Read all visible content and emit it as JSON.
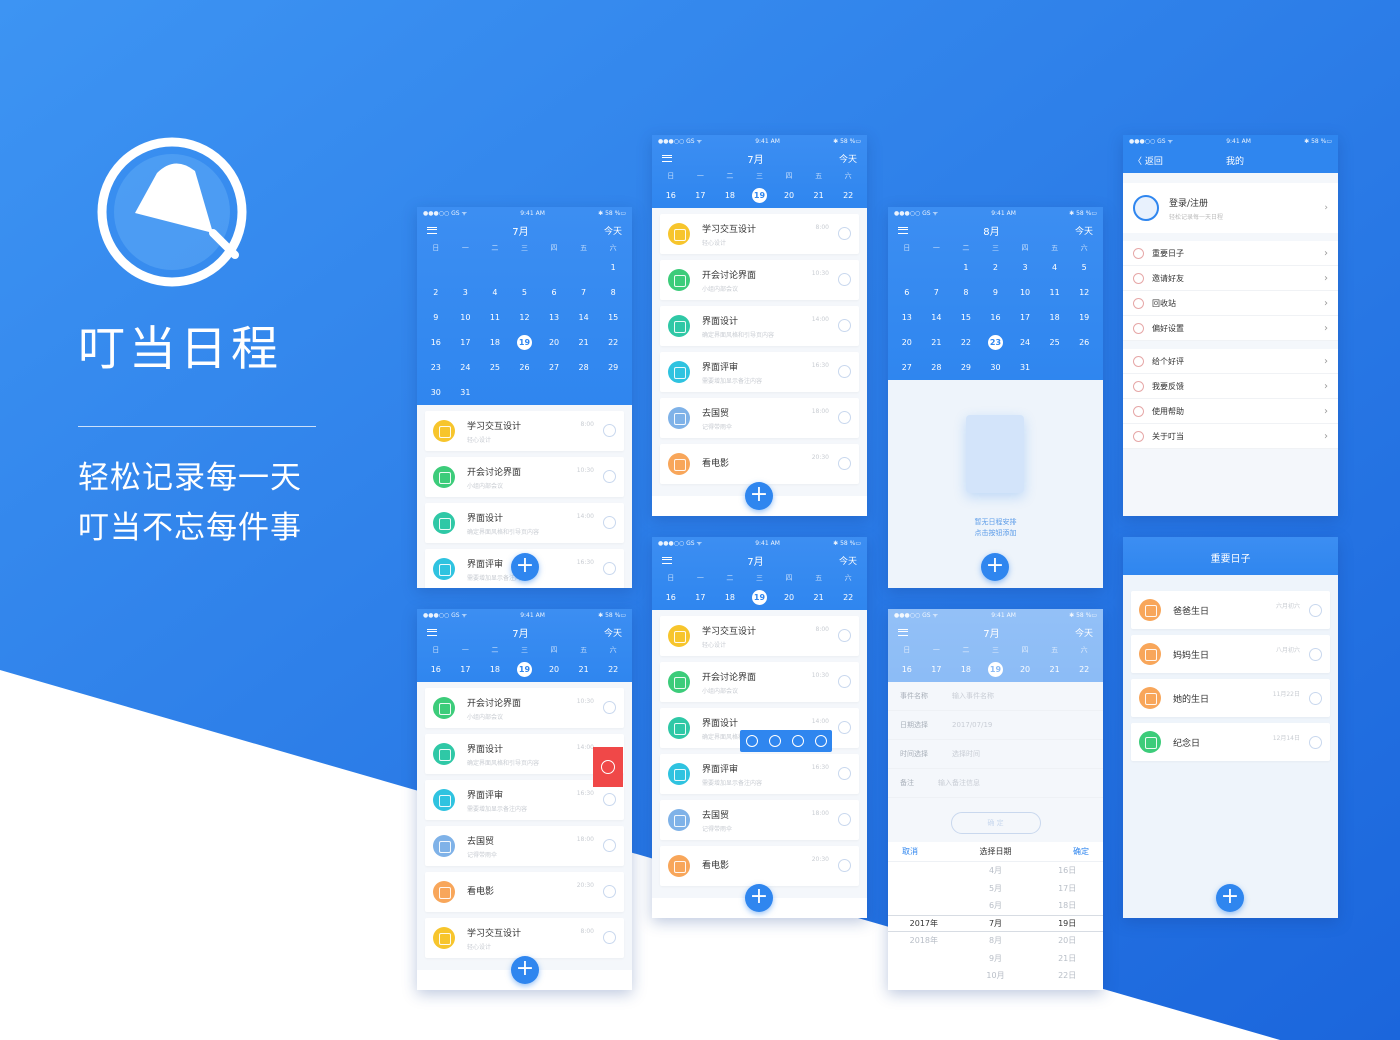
{
  "brand": {
    "title": "叮当日程",
    "slogan_1": "轻松记录每一天",
    "slogan_2": "叮当不忘每件事"
  },
  "status": {
    "carrier": "●●●○○ GS ᯤ",
    "time": "9:41 AM",
    "battery": "✱ 58 %▭"
  },
  "weekdays": [
    "日",
    "一",
    "二",
    "三",
    "四",
    "五",
    "六"
  ],
  "today_label": "今天",
  "month_july": "7月",
  "month_aug": "8月",
  "july_weeks": [
    [
      "",
      "",
      "",
      "",
      "",
      "",
      "1"
    ],
    [
      "2",
      "3",
      "4",
      "5",
      "6",
      "7",
      "8"
    ],
    [
      "9",
      "10",
      "11",
      "12",
      "13",
      "14",
      "15"
    ],
    [
      "16",
      "17",
      "18",
      "19",
      "20",
      "21",
      "22"
    ],
    [
      "23",
      "24",
      "25",
      "26",
      "27",
      "28",
      "29"
    ],
    [
      "30",
      "31",
      "",
      "",
      "",
      "",
      ""
    ]
  ],
  "aug_weeks": [
    [
      "",
      "",
      "1",
      "2",
      "3",
      "4",
      "5"
    ],
    [
      "6",
      "7",
      "8",
      "9",
      "10",
      "11",
      "12"
    ],
    [
      "13",
      "14",
      "15",
      "16",
      "17",
      "18",
      "19"
    ],
    [
      "20",
      "21",
      "22",
      "23",
      "24",
      "25",
      "26"
    ],
    [
      "27",
      "28",
      "29",
      "30",
      "31",
      "",
      ""
    ]
  ],
  "week_row": [
    "16",
    "17",
    "18",
    "19",
    "20",
    "21",
    "22"
  ],
  "events": [
    {
      "title": "学习交互设计",
      "sub": "轻心设计",
      "time": "8:00",
      "color": "c-yellow"
    },
    {
      "title": "开会讨论界面",
      "sub": "小组内部会议",
      "time": "10:30",
      "color": "c-green"
    },
    {
      "title": "界面设计",
      "sub": "确定界面风格和引导页内容",
      "time": "14:00",
      "color": "c-teal"
    },
    {
      "title": "界面评审",
      "sub": "需要增加显示备注内容",
      "time": "16:30",
      "color": "c-cyan"
    },
    {
      "title": "去国贸",
      "sub": "记得带雨伞",
      "time": "18:00",
      "color": "c-blue"
    },
    {
      "title": "看电影",
      "sub": "",
      "time": "20:30",
      "color": "c-orange"
    }
  ],
  "empty": {
    "line1": "暂无日程安排",
    "line2": "点击按钮添加"
  },
  "form": {
    "name_label": "事件名称",
    "name_ph": "输入事件名称",
    "date_label": "日期选择",
    "date_val": "2017/07/19",
    "time_label": "时间选择",
    "time_val": "选择时间",
    "note_label": "备注",
    "note_ph": "输入备注信息",
    "confirm": "确 定"
  },
  "picker": {
    "cancel": "取消",
    "title": "选择日期",
    "ok": "确定",
    "rows": [
      [
        "",
        "4月",
        "16日"
      ],
      [
        "",
        "5月",
        "17日"
      ],
      [
        "",
        "6月",
        "18日"
      ],
      [
        "2017年",
        "7月",
        "19日"
      ],
      [
        "2018年",
        "8月",
        "20日"
      ],
      [
        "",
        "9月",
        "21日"
      ],
      [
        "",
        "10月",
        "22日"
      ]
    ]
  },
  "me": {
    "back": "〈 返回",
    "title": "我的",
    "login": "登录/注册",
    "login_sub": "轻松记录每一天日程",
    "menu1": [
      "重要日子",
      "邀请好友",
      "回收站",
      "偏好设置"
    ],
    "menu2": [
      "给个好评",
      "我要反馈",
      "使用帮助",
      "关于叮当"
    ]
  },
  "important": {
    "title": "重要日子",
    "items": [
      {
        "name": "爸爸生日",
        "date": "六月初六",
        "color": "c-orange"
      },
      {
        "name": "妈妈生日",
        "date": "八月初六",
        "color": "c-orange"
      },
      {
        "name": "她的生日",
        "date": "11月22日",
        "color": "c-orange"
      },
      {
        "name": "纪念日",
        "date": "12月14日",
        "color": "c-green"
      }
    ]
  },
  "colors": {
    "accent": "#2f86ef",
    "bg_top": "#3a8ff0",
    "bg_bottom": "#1f6fe0"
  }
}
